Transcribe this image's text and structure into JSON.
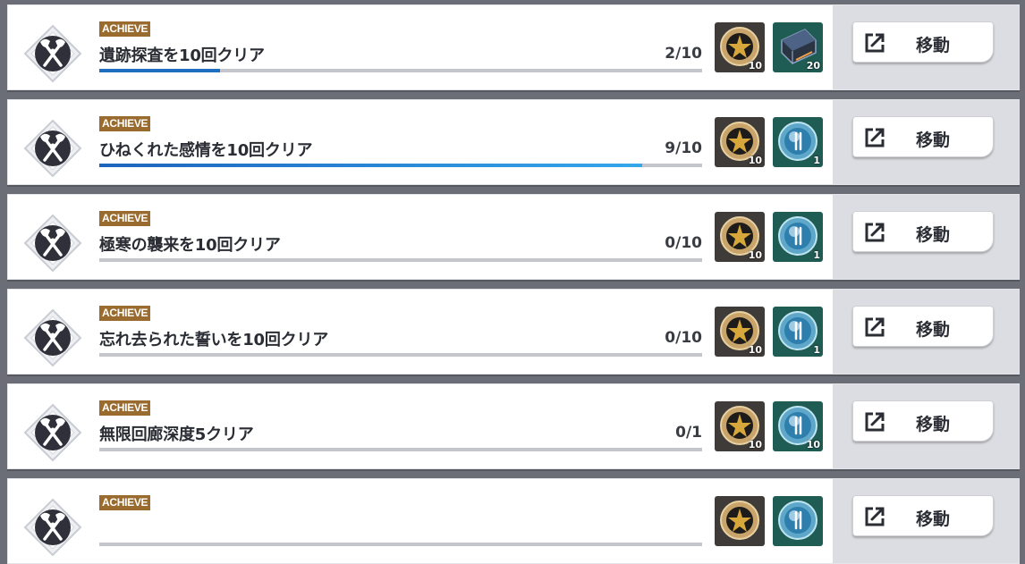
{
  "tag_label": "ACHIEVE",
  "move_label": "移動",
  "colors": {
    "tag_bg": "#9a6b2f",
    "progress": "#1f6fc0",
    "progress_end": "#35a7ea"
  },
  "rows": [
    {
      "title": "遺跡探査を10回クリア",
      "count": "2/10",
      "progress": 0.2,
      "rewards": [
        {
          "icon": "gold-coin-icon",
          "qty": "10"
        },
        {
          "icon": "steel-ingot-icon",
          "qty": "20"
        }
      ]
    },
    {
      "title": "ひねくれた感情を10回クリア",
      "count": "9/10",
      "progress": 0.9,
      "rewards": [
        {
          "icon": "gold-coin-icon",
          "qty": "10"
        },
        {
          "icon": "blue-orb-icon",
          "qty": "1"
        }
      ]
    },
    {
      "title": "極寒の襲来を10回クリア",
      "count": "0/10",
      "progress": 0,
      "rewards": [
        {
          "icon": "gold-coin-icon",
          "qty": "10"
        },
        {
          "icon": "blue-orb-icon",
          "qty": "1"
        }
      ]
    },
    {
      "title": "忘れ去られた誓いを10回クリア",
      "count": "0/10",
      "progress": 0,
      "rewards": [
        {
          "icon": "gold-coin-icon",
          "qty": "10"
        },
        {
          "icon": "blue-orb-icon",
          "qty": "1"
        }
      ]
    },
    {
      "title": "無限回廊深度5クリア",
      "count": "0/1",
      "progress": 0,
      "rewards": [
        {
          "icon": "gold-coin-icon",
          "qty": "10"
        },
        {
          "icon": "blue-orb-icon",
          "qty": "10"
        }
      ]
    },
    {
      "title": "",
      "count": "",
      "progress": 0,
      "rewards": [
        {
          "icon": "gold-coin-icon",
          "qty": ""
        },
        {
          "icon": "blue-orb-icon",
          "qty": ""
        }
      ]
    }
  ]
}
